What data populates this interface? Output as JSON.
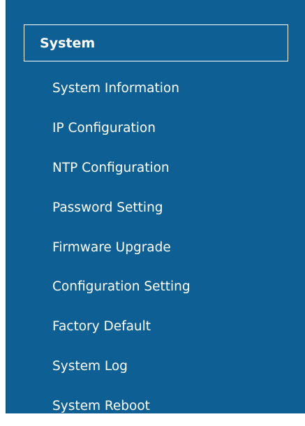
{
  "sidebar": {
    "section_title": "System",
    "items": [
      {
        "label": "System Information"
      },
      {
        "label": "IP Configuration"
      },
      {
        "label": "NTP Configuration"
      },
      {
        "label": "Password Setting"
      },
      {
        "label": "Firmware Upgrade"
      },
      {
        "label": "Configuration Setting"
      },
      {
        "label": "Factory Default"
      },
      {
        "label": "System Log"
      },
      {
        "label": "System Reboot"
      }
    ]
  },
  "colors": {
    "sidebar_background": "#0e6094",
    "text": "#ffffff",
    "header_border": "#ffffff"
  }
}
